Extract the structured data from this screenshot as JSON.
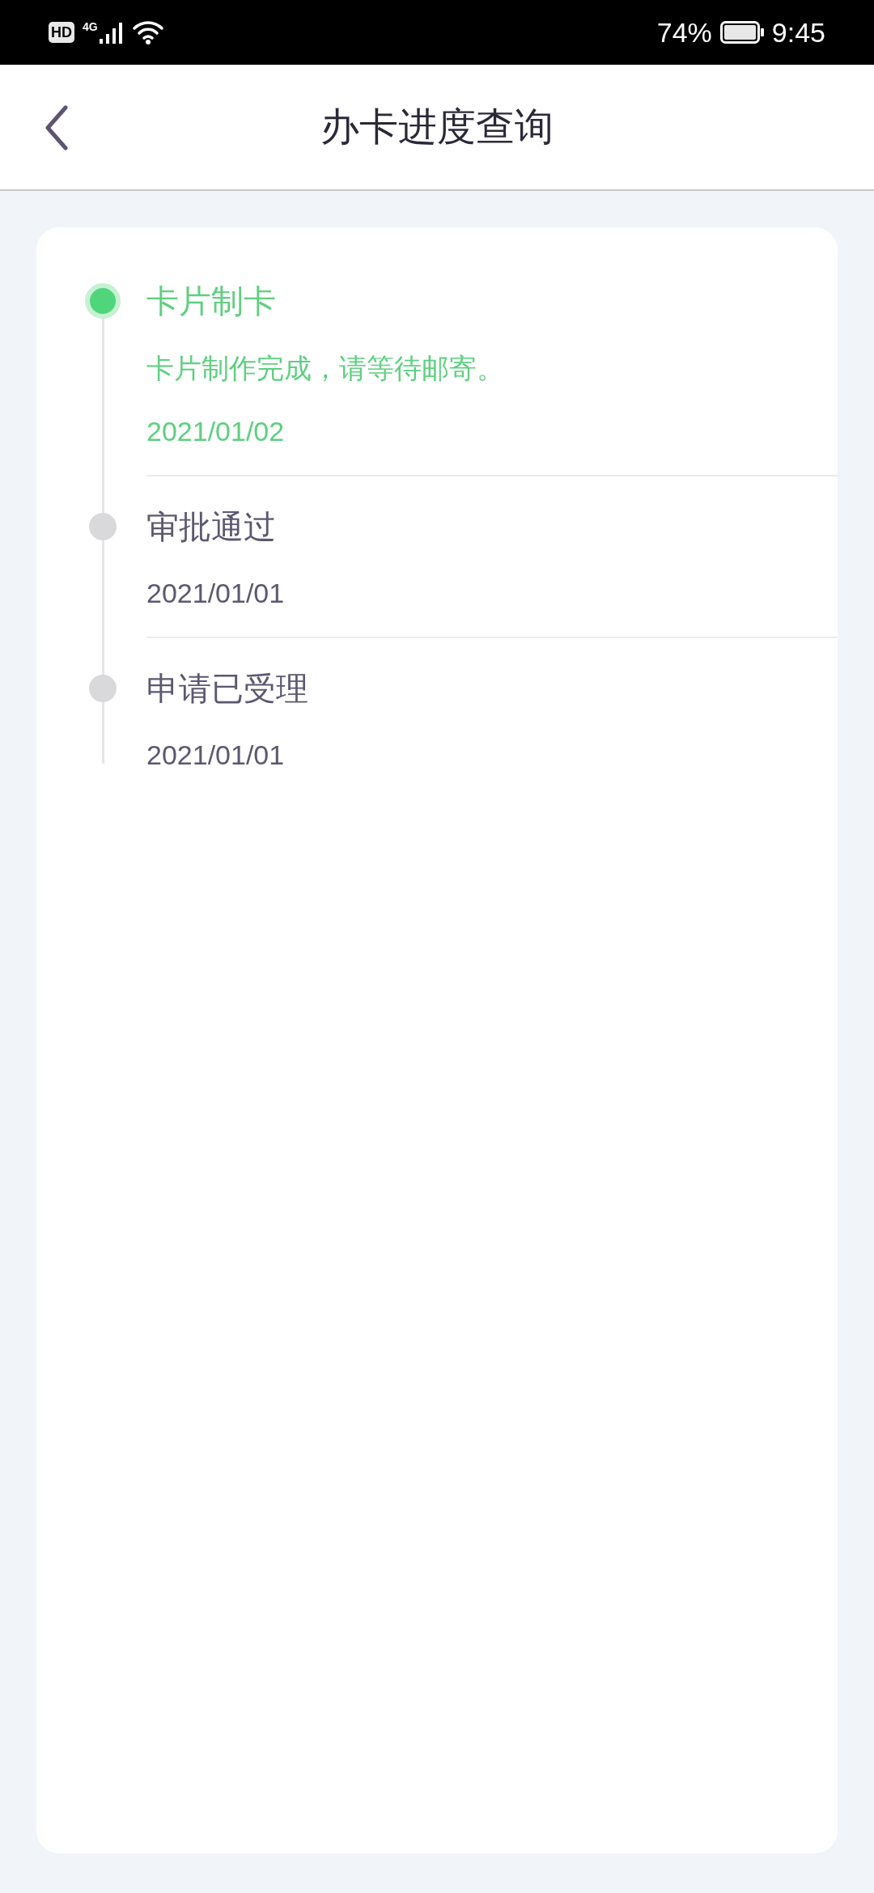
{
  "status_bar": {
    "hd": "HD",
    "network": "4G",
    "battery": "74%",
    "time": "9:45"
  },
  "header": {
    "title": "办卡进度查询"
  },
  "timeline": [
    {
      "title": "卡片制卡",
      "description": "卡片制作完成，请等待邮寄。",
      "date": "2021/01/02",
      "active": true
    },
    {
      "title": "审批通过",
      "date": "2021/01/01",
      "active": false
    },
    {
      "title": "申请已受理",
      "date": "2021/01/01",
      "active": false
    }
  ]
}
